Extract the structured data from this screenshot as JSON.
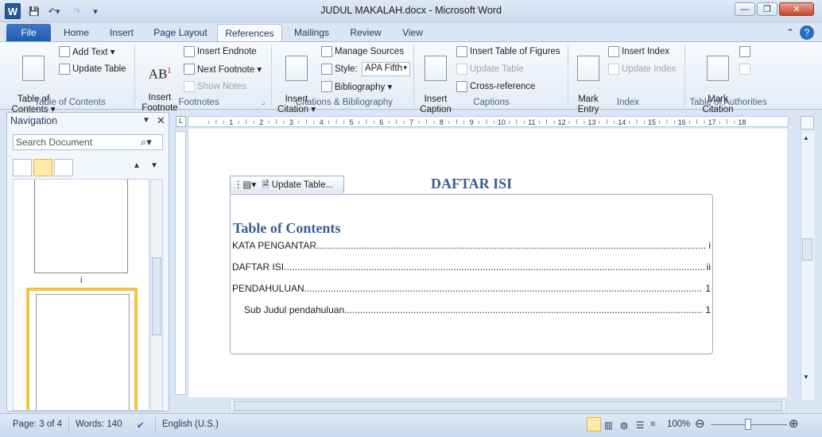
{
  "window": {
    "title": "JUDUL MAKALAH.docx  -  Microsoft Word",
    "app_icon": "W"
  },
  "tabs": [
    {
      "label": "File"
    },
    {
      "label": "Home"
    },
    {
      "label": "Insert"
    },
    {
      "label": "Page Layout"
    },
    {
      "label": "References"
    },
    {
      "label": "Mailings"
    },
    {
      "label": "Review"
    },
    {
      "label": "View"
    }
  ],
  "ribbon": {
    "toc": {
      "label": "Table of\nContents ▾",
      "add_text": "Add Text ▾",
      "update_table": "Update Table",
      "group": "Table of Contents"
    },
    "footnotes": {
      "insert_footnote": "Insert\nFootnote",
      "icon_text": "AB",
      "insert_endnote": "Insert Endnote",
      "next_footnote": "Next Footnote ▾",
      "show_notes": "Show Notes",
      "group": "Footnotes"
    },
    "citations": {
      "insert_citation": "Insert\nCitation ▾",
      "manage_sources": "Manage Sources",
      "style_label": "Style:",
      "style_value": "APA Fifth",
      "bibliography": "Bibliography ▾",
      "group": "Citations & Bibliography"
    },
    "captions": {
      "insert_caption": "Insert\nCaption",
      "insert_tof": "Insert Table of Figures",
      "update_table": "Update Table",
      "cross_reference": "Cross-reference",
      "group": "Captions"
    },
    "index": {
      "mark_entry": "Mark\nEntry",
      "insert_index": "Insert Index",
      "update_index": "Update Index",
      "group": "Index"
    },
    "toa": {
      "mark_citation": "Mark\nCitation",
      "group": "Table of Authorities"
    }
  },
  "nav": {
    "title": "Navigation",
    "search_placeholder": "Search Document",
    "page_label": "i"
  },
  "document": {
    "header_tab": "Update Table...",
    "heading": "DAFTAR ISI",
    "toc_title": "Table of Contents",
    "entries": [
      {
        "text": "KATA PENGANTAR",
        "page": "i"
      },
      {
        "text": "DAFTAR ISI",
        "page": "ii"
      },
      {
        "text": "PENDAHULUAN",
        "page": "1"
      },
      {
        "text": "Sub Judul pendahuluan",
        "page": "1"
      }
    ]
  },
  "ruler": {
    "numbers": [
      "1",
      "2",
      "3",
      "4",
      "5",
      "6",
      "7",
      "8",
      "9",
      "10",
      "11",
      "12",
      "13",
      "14",
      "15",
      "16",
      "17",
      "18"
    ]
  },
  "status": {
    "page": "Page: 3 of 4",
    "words": "Words: 140",
    "language": "English (U.S.)",
    "zoom": "100%"
  }
}
